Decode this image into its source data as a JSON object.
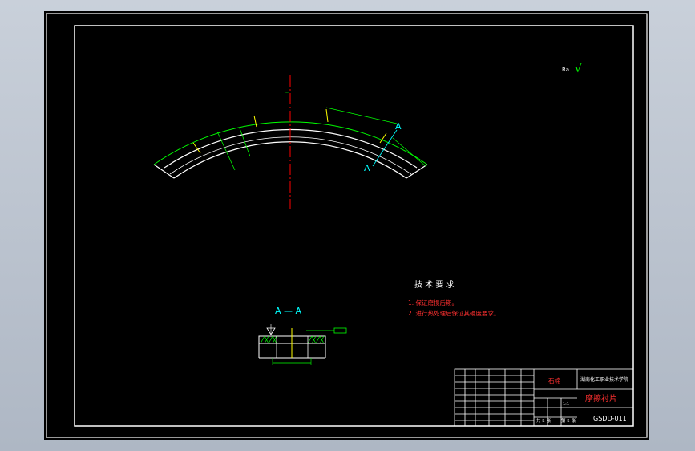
{
  "drawing": {
    "section_marks": {
      "a1": "A",
      "a2": "A"
    },
    "roughness_symbol": "√",
    "section_title": "A — A",
    "tech_title": "技 术 要 求",
    "tech_notes": [
      "1. 保证磨损后期。",
      "2. 进行热处理后保证其硬度要求。"
    ],
    "title_block": {
      "material": "石棉",
      "school": "湖南化工职业技术学院",
      "part_name": "摩擦衬片",
      "drawing_no": "GSDD-011",
      "scale": "1:1",
      "sheets_total": "共 5 张",
      "sheet_no": "第 5 张"
    },
    "colors": {
      "frame": "#ffffff",
      "geometry": "#ffffff",
      "dimension": "#00ff00",
      "centerline": "#ff0000",
      "cyan": "#00ffff",
      "yellow": "#ffff00",
      "red_text": "#ff3030"
    }
  }
}
